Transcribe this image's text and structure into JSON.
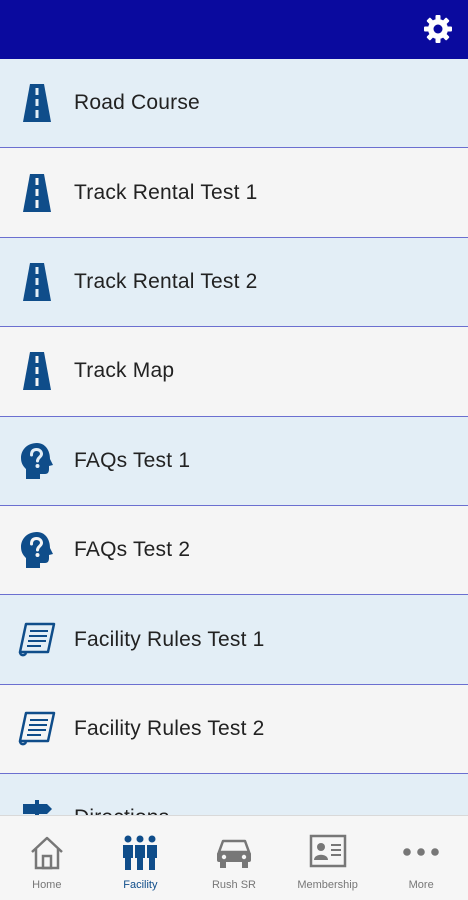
{
  "header": {
    "settings_icon": "gear-icon",
    "color": "#0a0a9e"
  },
  "list": {
    "items": [
      {
        "label": "Road Course",
        "icon": "road-icon"
      },
      {
        "label": "Track Rental Test 1",
        "icon": "road-icon"
      },
      {
        "label": "Track Rental Test 2",
        "icon": "road-icon"
      },
      {
        "label": "Track Map",
        "icon": "road-icon"
      },
      {
        "label": "FAQs Test 1",
        "icon": "question-head-icon"
      },
      {
        "label": "FAQs Test 2",
        "icon": "question-head-icon"
      },
      {
        "label": "Facility Rules Test 1",
        "icon": "document-icon"
      },
      {
        "label": "Facility Rules Test 2",
        "icon": "document-icon"
      },
      {
        "label": "Directions",
        "icon": "signpost-icon"
      }
    ]
  },
  "tabs": [
    {
      "label": "Home",
      "icon": "home-icon",
      "active": false
    },
    {
      "label": "Facility",
      "icon": "people-icon",
      "active": true
    },
    {
      "label": "Rush SR",
      "icon": "car-icon",
      "active": false
    },
    {
      "label": "Membership",
      "icon": "id-card-icon",
      "active": false
    },
    {
      "label": "More",
      "icon": "more-icon",
      "active": false
    }
  ],
  "colors": {
    "accent": "#0f4d8a",
    "row_alt": "#e3eef6",
    "divider": "#6b6fd0"
  }
}
